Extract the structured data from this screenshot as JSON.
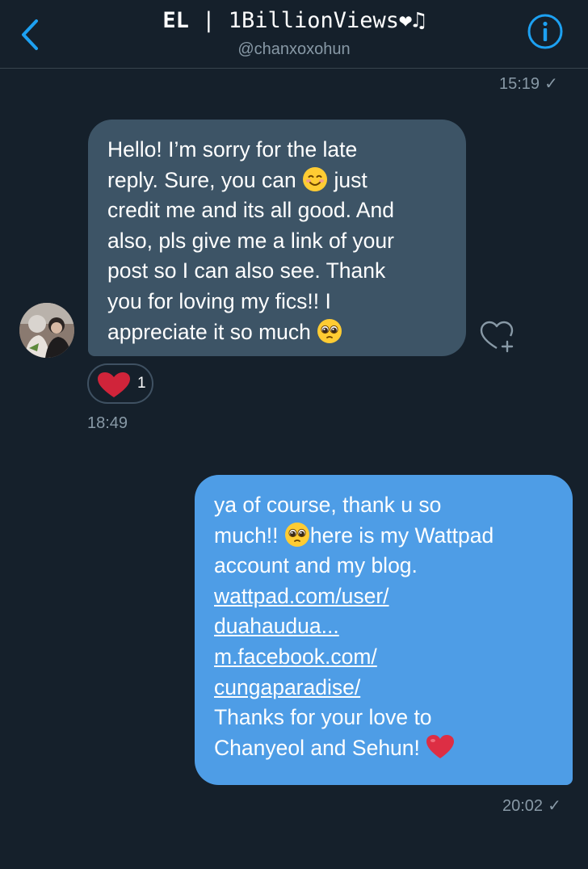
{
  "header": {
    "title_bold": "EL",
    "title_separator": " | ",
    "title_rest": "1BillionViews",
    "title_symbols": "❤♫",
    "handle": "@chanxoxohun",
    "back_icon": "chevron-left-icon",
    "info_icon": "info-icon"
  },
  "colors": {
    "background": "#15202b",
    "incoming_bubble": "#3d5466",
    "outgoing_bubble": "#4e9de6",
    "accent": "#1da1f2",
    "muted_text": "#8899a6",
    "reaction_heart": "#e0245e"
  },
  "messages": [
    {
      "direction": "incoming",
      "lines": [
        "Hello! I’m sorry for the late",
        "reply. Sure, you can",
        "just",
        "credit me and its all good. And",
        "also, pls give me a link of your",
        "post so I can also see. Thank",
        "you for loving my fics!! I",
        "appreciate it so much"
      ],
      "emojis": [
        "smiling-face-emoji",
        "pleading-face-emoji"
      ],
      "reaction": {
        "icon": "heart-icon",
        "count": "1"
      },
      "add_reaction_icon": "heart-plus-icon",
      "time": "18:49"
    },
    {
      "direction": "outgoing",
      "lines": [
        "ya of course, thank u so",
        "much!!",
        "here is my Wattpad",
        "account and my blog.",
        "wattpad.com/user/",
        "duahaudua...",
        "m.facebook.com/",
        "cungaparadise/",
        "Thanks for your love to",
        "Chanyeol and Sehun!"
      ],
      "emojis": [
        "pleading-face-emoji",
        "red-heart-emoji"
      ],
      "time": "20:02",
      "status": "✓"
    }
  ],
  "top_timestamp": {
    "time": "15:19",
    "status": "✓"
  }
}
